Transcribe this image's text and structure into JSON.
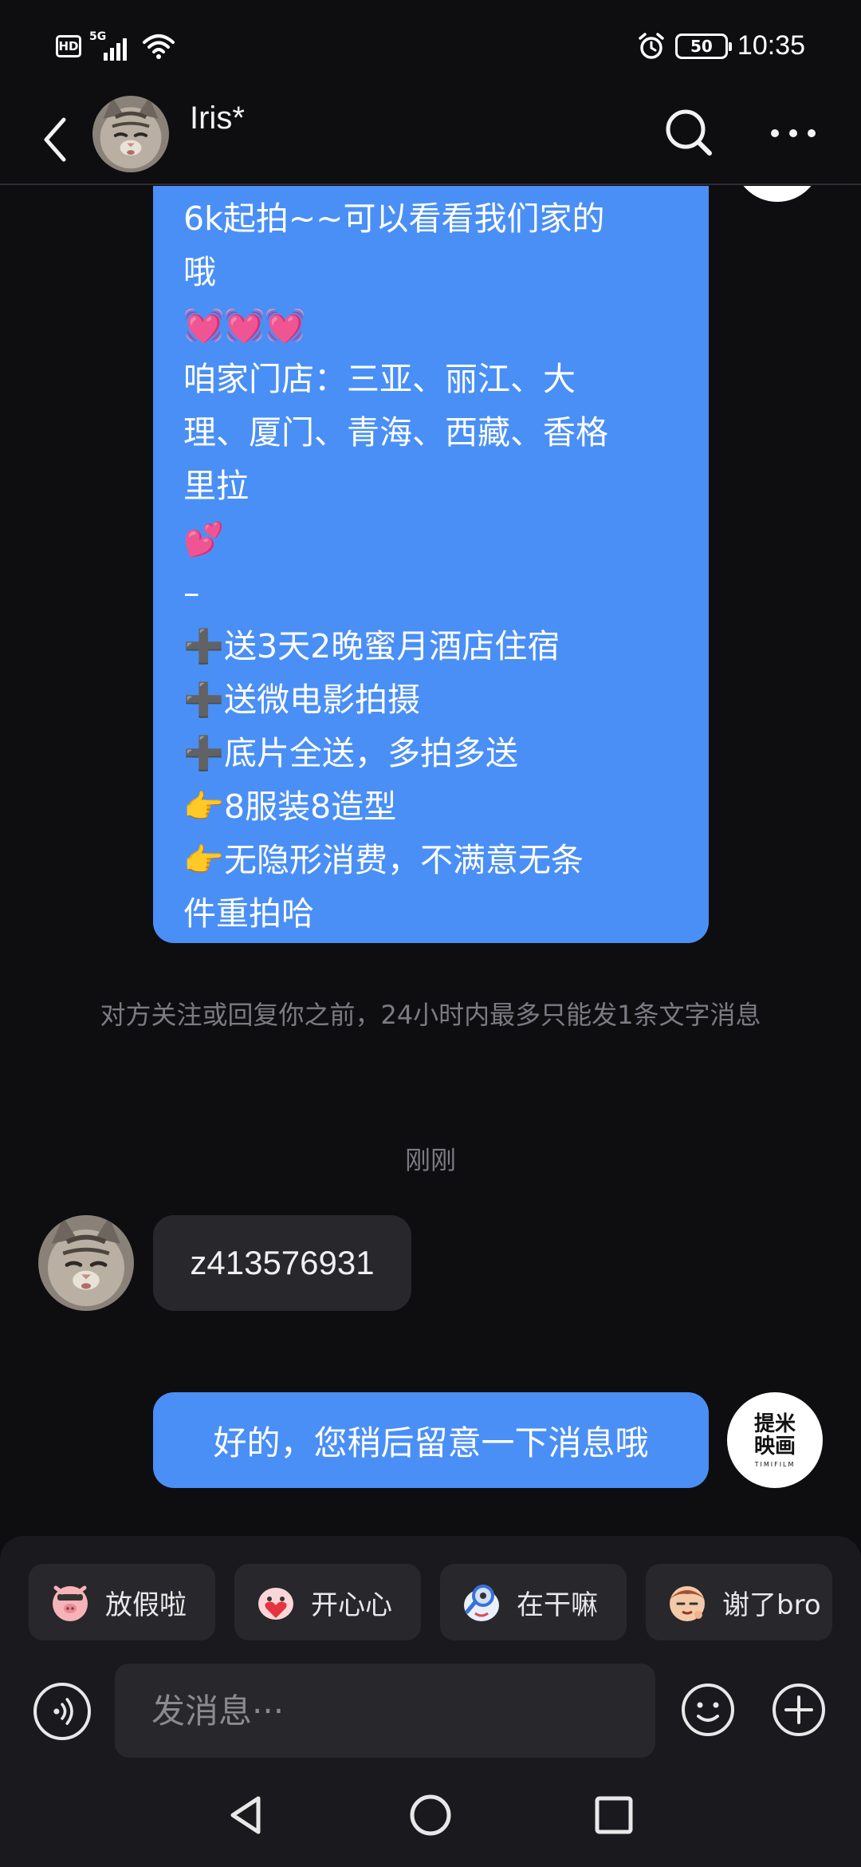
{
  "status_bar": {
    "hd": "HD",
    "network": "5G",
    "battery": "50",
    "time": "10:35"
  },
  "header": {
    "contact_name": "Iris*",
    "icons": [
      "back-arrow-icon",
      "search-icon",
      "more-icon"
    ]
  },
  "messages": {
    "promo_text": "6k起拍~~可以看看我们家的\n哦\n💓💓💓\n咱家门店：三亚、丽江、大\n理、厦门、青海、西藏、香格\n里拉\n💕\n–\n➕送3天2晚蜜月酒店住宿\n➕送微电影拍摄\n➕底片全送，多拍多送\n👉8服装8造型\n👉无隐形消费，不满意无条\n件重拍哈",
    "notice": "对方关注或回复你之前，24小时内最多只能发1条文字消息",
    "time_label": "刚刚",
    "received": "z413576931",
    "sent": "好的，您稍后留意一下消息哦",
    "sender_logo": {
      "line1": "提米",
      "line2": "映画",
      "sub": "TIMIFILM"
    }
  },
  "quick_replies": [
    {
      "label": "放假啦",
      "icon": "pig-sticker-icon"
    },
    {
      "label": "开心心",
      "icon": "pink-blob-heart-sticker-icon"
    },
    {
      "label": "在干嘛",
      "icon": "magnifier-sticker-icon"
    },
    {
      "label": "谢了bro",
      "icon": "cool-face-sticker-icon"
    }
  ],
  "input": {
    "placeholder": "发消息···"
  },
  "colors": {
    "sent_bubble": "#4a8ff5",
    "received_bubble": "#27272c",
    "background": "#0e0e11"
  }
}
